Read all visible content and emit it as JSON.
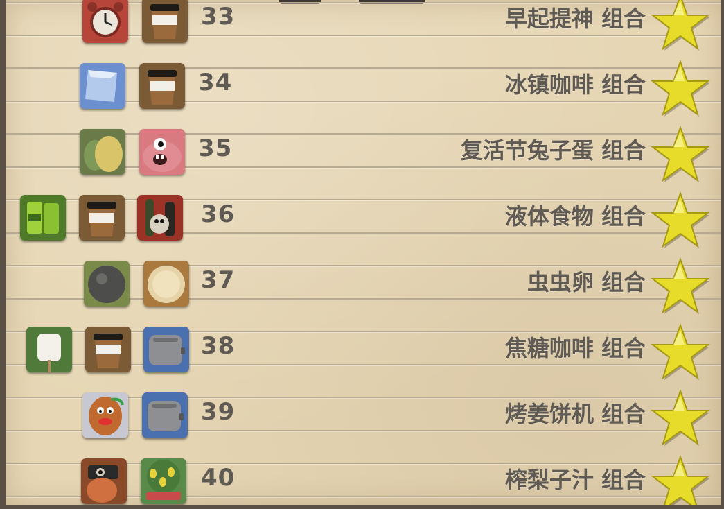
{
  "rows": [
    {
      "number": "33",
      "name": "早起提神 组合",
      "icons": [
        "alarm-clock-icon",
        "coffee-cup-icon"
      ],
      "star": "gold"
    },
    {
      "number": "34",
      "name": "冰镇咖啡 组合",
      "icons": [
        "ice-cube-icon",
        "coffee-cup-icon"
      ],
      "star": "gold"
    },
    {
      "number": "35",
      "name": "复活节兔子蛋 组合",
      "icons": [
        "eggs-icon",
        "pink-monster-icon"
      ],
      "star": "gold"
    },
    {
      "number": "36",
      "name": "液体食物 组合",
      "icons": [
        "soda-cans-icon",
        "coffee-cup-icon",
        "bottles-icon"
      ],
      "star": "gold"
    },
    {
      "number": "37",
      "name": "虫虫卵 组合",
      "icons": [
        "dark-ball-icon",
        "bread-roll-icon"
      ],
      "star": "gold"
    },
    {
      "number": "38",
      "name": "焦糖咖啡 组合",
      "icons": [
        "marshmallow-icon",
        "coffee-cup-icon",
        "toaster-icon"
      ],
      "star": "gold"
    },
    {
      "number": "39",
      "name": "烤姜饼机 组合",
      "icons": [
        "gingerbread-man-icon",
        "toaster-icon"
      ],
      "star": "gold"
    },
    {
      "number": "40",
      "name": "榨梨子汁 组合",
      "icons": [
        "juicer-robot-icon",
        "pear-tree-icon"
      ],
      "star": "gold"
    }
  ],
  "colors": {
    "paper": "#e6d6b4",
    "text": "#5f5a53",
    "star": "#e8dc2a",
    "frame": "#5b5046"
  }
}
